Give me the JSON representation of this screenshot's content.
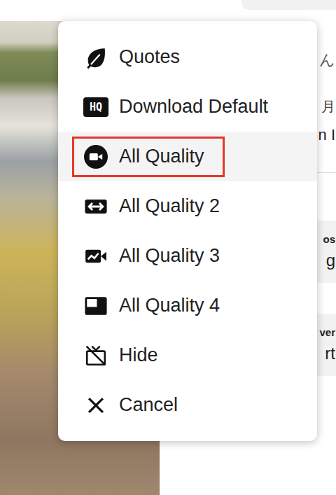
{
  "page": {
    "header_fragment": "ん",
    "lines": [
      {
        "text": "月"
      },
      {
        "text": "n I"
      }
    ],
    "cards": [
      {
        "title": "os",
        "body": "g"
      },
      {
        "title": "ver",
        "body": "rt"
      }
    ]
  },
  "menu": {
    "items": [
      {
        "label": "Quotes",
        "kind": "leaf",
        "selected": false
      },
      {
        "label": "Download Default",
        "kind": "hq",
        "badge": "HQ",
        "selected": false
      },
      {
        "label": "All Quality",
        "kind": "camera",
        "selected": true
      },
      {
        "label": "All Quality 2",
        "kind": "swap",
        "selected": false
      },
      {
        "label": "All Quality 3",
        "kind": "video-check",
        "selected": false
      },
      {
        "label": "All Quality 4",
        "kind": "window",
        "selected": false
      },
      {
        "label": "Hide",
        "kind": "tv-off",
        "selected": false
      },
      {
        "label": "Cancel",
        "kind": "close",
        "selected": false
      }
    ]
  }
}
